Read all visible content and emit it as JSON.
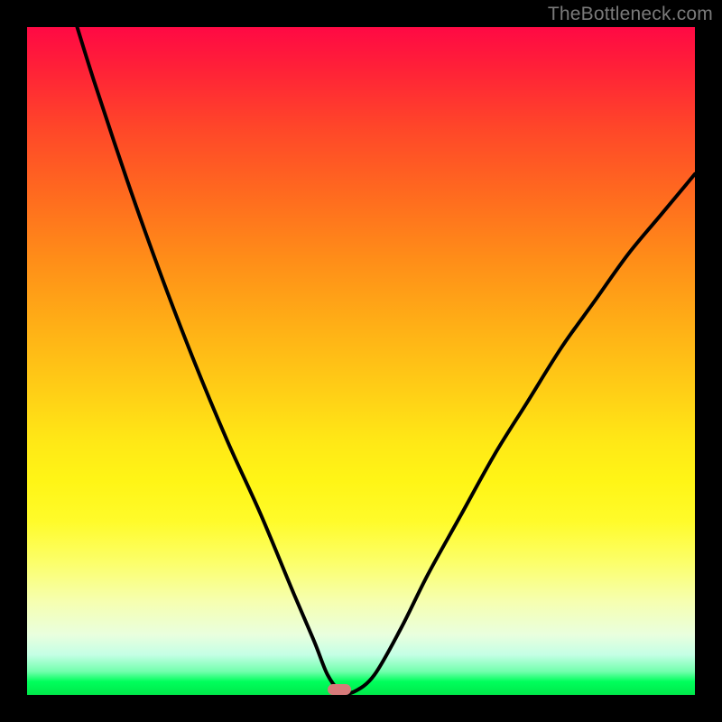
{
  "watermark": "TheBottleneck.com",
  "marker": {
    "x_pct": 46.8,
    "y_pct": 99.2
  },
  "chart_data": {
    "type": "line",
    "title": "",
    "xlabel": "",
    "ylabel": "",
    "xlim": [
      0,
      100
    ],
    "ylim": [
      0,
      100
    ],
    "series": [
      {
        "name": "bottleneck-curve",
        "x": [
          7.5,
          10,
          15,
          20,
          25,
          30,
          35,
          40,
          43,
          45,
          47,
          49,
          52,
          56,
          60,
          65,
          70,
          75,
          80,
          85,
          90,
          95,
          100
        ],
        "y": [
          100,
          92,
          77,
          63,
          50,
          38,
          27,
          15,
          8,
          3,
          0.5,
          0.5,
          3,
          10,
          18,
          27,
          36,
          44,
          52,
          59,
          66,
          72,
          78
        ]
      }
    ],
    "annotations": [
      {
        "type": "marker",
        "x": 47,
        "y": 0.8,
        "color": "#d77a7a"
      }
    ],
    "background_gradient_top": "#ff0944",
    "background_gradient_bottom": "#00e84a"
  }
}
